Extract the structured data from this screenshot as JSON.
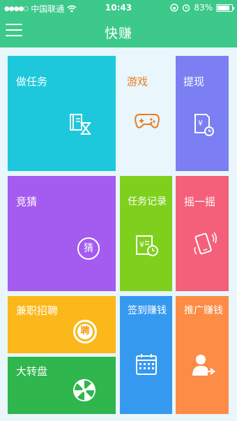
{
  "statusbar": {
    "signal_dots": "●●●●○",
    "carrier": "中国联通",
    "time": "10:43",
    "battery_percent": "83%",
    "battery_level": 0.83
  },
  "appbar": {
    "title": "快赚"
  },
  "tiles": {
    "task": "做任务",
    "game": "游戏",
    "withdraw": "提现",
    "guess": "竞猜",
    "guess_badge": "猜",
    "record": "任务记录",
    "shake": "摇一摇",
    "parttime": "兼职招聘",
    "parttime_badge": "聘",
    "wheel": "大转盘",
    "checkin": "签到赚钱",
    "promote": "推广赚钱"
  }
}
